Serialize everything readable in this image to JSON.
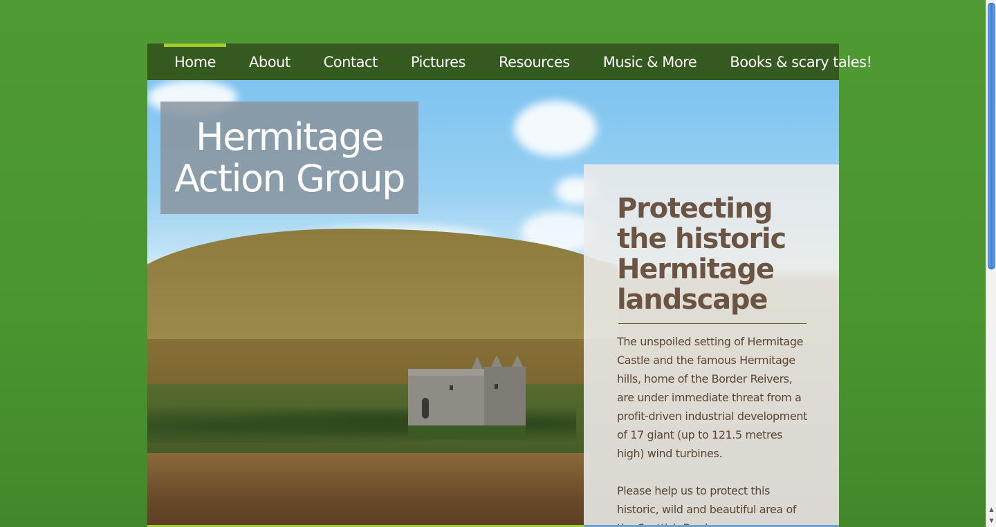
{
  "nav": {
    "items": [
      {
        "label": "Home",
        "active": true
      },
      {
        "label": "About"
      },
      {
        "label": "Contact"
      },
      {
        "label": "Pictures"
      },
      {
        "label": "Resources"
      },
      {
        "label": "Music & More"
      },
      {
        "label": "Books & scary tales!"
      }
    ]
  },
  "hero": {
    "title_line1": "Hermitage",
    "title_line2": "Action Group"
  },
  "info": {
    "heading": "Protecting the historic Hermitage landscape",
    "paragraph1": "The unspoiled setting of Hermitage Castle and the famous Hermitage hills, home of the Border Reivers, are under immediate threat from a profit-driven industrial development of 17 giant (up to 121.5 metres high) wind turbines.",
    "paragraph2": "Please help us to protect this historic, wild and beautiful area of the Scottish Borders."
  },
  "colors": {
    "background": "#4f9a33",
    "navbar": "#345a1f",
    "nav_active_accent": "#a6cc2a",
    "info_text": "#6b5441"
  },
  "scrollbar": {
    "up_icon": "scroll-up-arrow-icon",
    "down_icon": "scroll-down-arrow-icon"
  }
}
